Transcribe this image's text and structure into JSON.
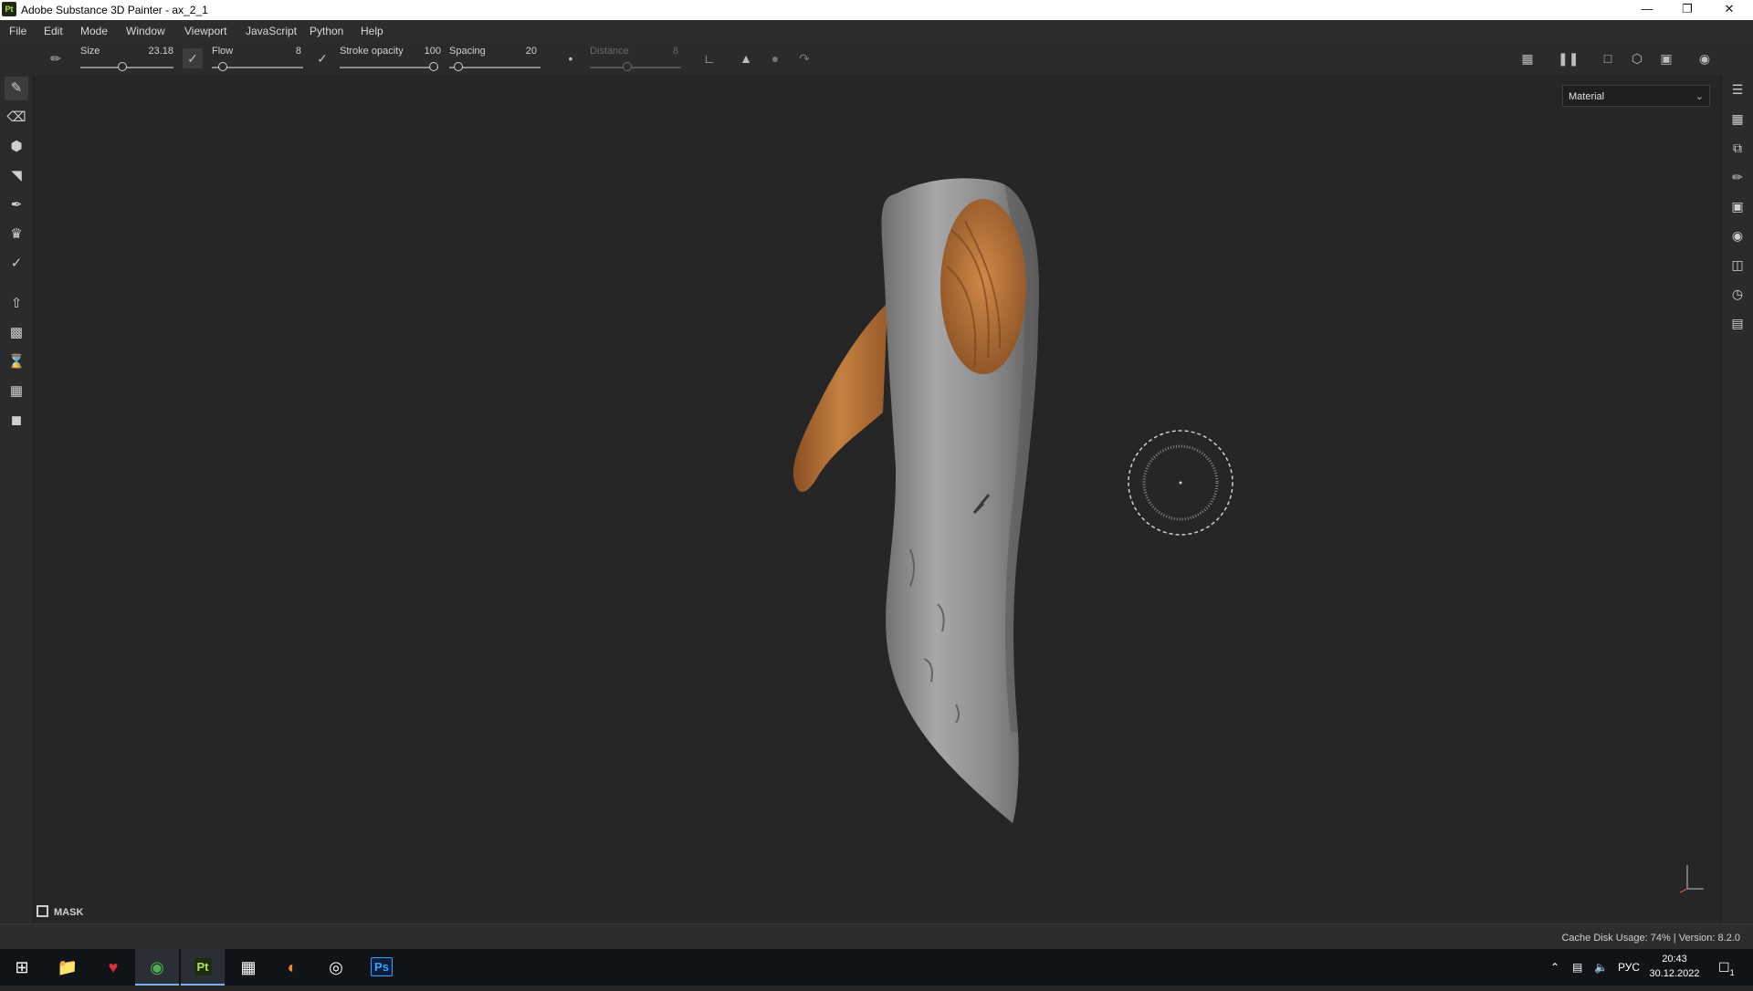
{
  "window": {
    "title": "Adobe Substance 3D Painter - ax_2_1",
    "app_badge": "Pt"
  },
  "menu": [
    "File",
    "Edit",
    "Mode",
    "Window",
    "Viewport",
    "JavaScript",
    "Python",
    "Help"
  ],
  "tool_options": {
    "size": {
      "label": "Size",
      "value": "23.18",
      "fraction": 0.45
    },
    "flow": {
      "label": "Flow",
      "value": "8",
      "fraction": 0.08
    },
    "stroke_opacity": {
      "label": "Stroke opacity",
      "value": "100",
      "fraction": 1.0
    },
    "spacing": {
      "label": "Spacing",
      "value": "20",
      "fraction": 0.05
    },
    "distance": {
      "label": "Distance",
      "value": "8",
      "fraction": 0.4,
      "disabled": true
    }
  },
  "viewport": {
    "view_mode": "Material",
    "mask_label": "MASK"
  },
  "status": {
    "cache_label": "Cache Disk Usage:",
    "cache_value": "74%",
    "version": "Version: 8.2.0"
  },
  "taskbar": {
    "language": "РУС",
    "time": "20:43",
    "date": "30.12.2022",
    "notification_count": "1",
    "apps": [
      "windows-start-icon",
      "file-explorer-icon",
      "vivaldi-icon",
      "chrome-icon",
      "substance-painter-icon",
      "zbrush-icon",
      "blender-icon",
      "obs-icon",
      "photoshop-icon"
    ],
    "ps_label": "Ps",
    "pt_label": "Pt"
  },
  "colors": {
    "viewport_bg": "#262626",
    "panel_bg": "#2b2b2b",
    "taskbar_bg": "#101418",
    "painter_accent": "#b3e14f"
  }
}
